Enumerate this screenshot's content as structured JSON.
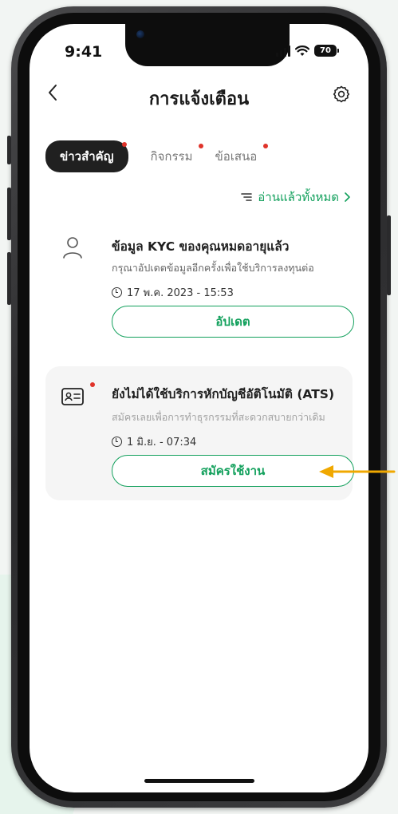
{
  "status_bar": {
    "time": "9:41",
    "battery": "70"
  },
  "header": {
    "title": "การแจ้งเตือน"
  },
  "tabs": [
    {
      "label": "ข่าวสำคัญ",
      "active": true,
      "has_dot": true
    },
    {
      "label": "กิจกรรม",
      "active": false,
      "has_dot": true
    },
    {
      "label": "ข้อเสนอ",
      "active": false,
      "has_dot": true
    }
  ],
  "mark_all_read": {
    "label": "อ่านแล้วทั้งหมด"
  },
  "notifications": [
    {
      "icon": "user-icon",
      "title": "ข้อมูล KYC ของคุณหมดอายุแล้ว",
      "description": "กรุณาอัปเดตข้อมูลอีกครั้งเพื่อใช้บริการลงทุนต่อ",
      "time": "17 พ.ค. 2023 - 15:53",
      "button": "อัปเดต",
      "unread": false
    },
    {
      "icon": "id-card-icon",
      "title": "ยังไม่ได้ใช้บริการหักบัญชีอัติโนมัติ (ATS)",
      "description": "สมัครเลยเพื่อการทำธุรกรรมที่สะดวกสบายกว่าเดิม",
      "time": "1 มิ.ย. - 07:34",
      "button": "สมัครใช้งาน",
      "unread": true
    }
  ],
  "colors": {
    "accent": "#12a05c",
    "dot": "#e0332a",
    "annotation_arrow": "#f0a800",
    "active_tab": "#202020"
  }
}
